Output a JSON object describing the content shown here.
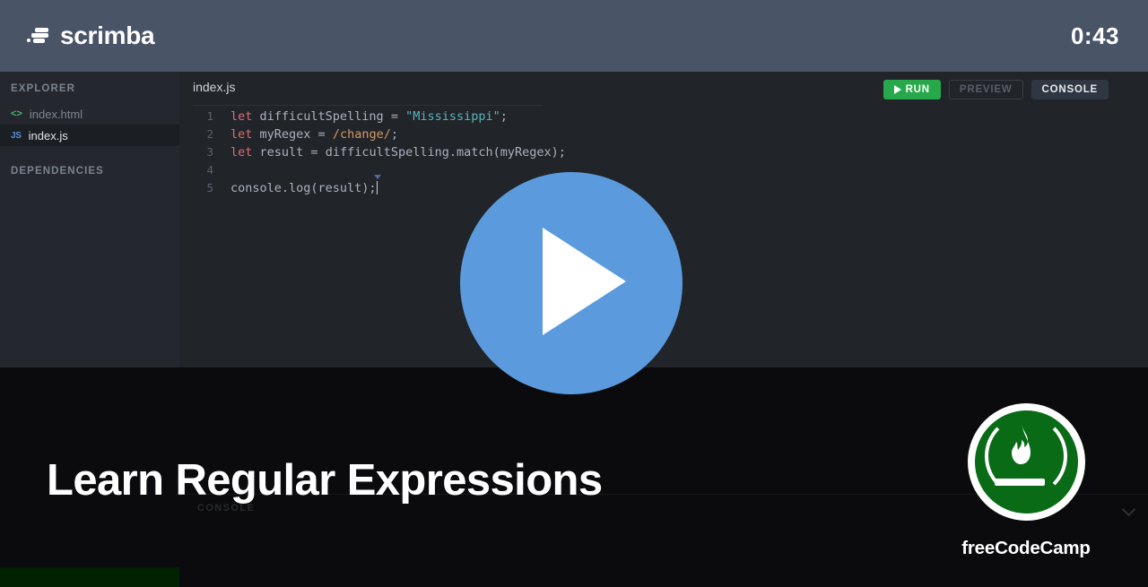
{
  "header": {
    "brand_name": "scrimba",
    "brand_icon": "scrimba-speed-lines-icon",
    "timer": "0:43"
  },
  "sidebar": {
    "explorer_label": "EXPLORER",
    "dependencies_label": "DEPENDENCIES",
    "files": [
      {
        "name": "index.html",
        "icon": "html-code-icon",
        "icon_glyph": "<>",
        "selected": false
      },
      {
        "name": "index.js",
        "icon": "javascript-icon",
        "icon_glyph": "JS",
        "selected": true
      }
    ]
  },
  "editor": {
    "active_tab": "index.js",
    "toolbar": {
      "run_label": "RUN",
      "preview_label": "PREVIEW",
      "console_label": "CONSOLE"
    },
    "lines": [
      {
        "number": "1",
        "tokens": [
          {
            "t": "let",
            "c": "t-kw"
          },
          {
            "t": " difficultSpelling ",
            "c": ""
          },
          {
            "t": "=",
            "c": "t-op"
          },
          {
            "t": " ",
            "c": ""
          },
          {
            "t": "\"Mississippi\"",
            "c": "t-str"
          },
          {
            "t": ";",
            "c": ""
          }
        ]
      },
      {
        "number": "2",
        "tokens": [
          {
            "t": "let",
            "c": "t-kw"
          },
          {
            "t": " myRegex ",
            "c": ""
          },
          {
            "t": "=",
            "c": "t-op"
          },
          {
            "t": " ",
            "c": ""
          },
          {
            "t": "/change/",
            "c": "t-rgx"
          },
          {
            "t": ";",
            "c": ""
          }
        ]
      },
      {
        "number": "3",
        "tokens": [
          {
            "t": "let",
            "c": "t-kw"
          },
          {
            "t": " result ",
            "c": ""
          },
          {
            "t": "=",
            "c": "t-op"
          },
          {
            "t": " difficultSpelling.match(myRegex);",
            "c": ""
          }
        ]
      },
      {
        "number": "4",
        "tokens": []
      },
      {
        "number": "5",
        "tokens": [
          {
            "t": "console.log(result);",
            "c": ""
          }
        ],
        "caret": true
      }
    ]
  },
  "console_panel": {
    "label": "CONSOLE",
    "collapse_icon": "chevron-down-icon"
  },
  "overlay": {
    "title": "Learn Regular Expressions",
    "play_icon": "play-button-icon",
    "brand": {
      "name": "freeCodeCamp",
      "logo_icon": "freecodecamp-flame-logo"
    }
  },
  "colors": {
    "header_bg": "#4a5467",
    "sidebar_bg": "#24282e",
    "editor_bg": "#212428",
    "run_green": "#27a84a",
    "play_blue": "#5b9bdd",
    "fcc_green": "#0a6b17",
    "keyword": "#e06c75",
    "string": "#56b6c2",
    "regex": "#d19a66"
  }
}
